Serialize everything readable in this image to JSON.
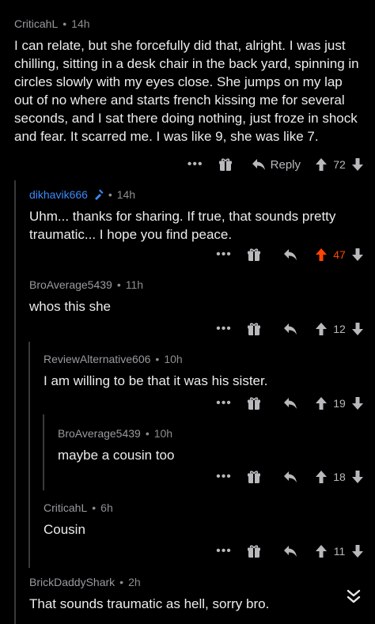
{
  "comments": [
    {
      "user": "CriticahL",
      "time": "14h",
      "mod": false,
      "text": "I can relate, but she forcefully did that, alright. I was just chilling, sitting in a desk chair in the back yard, spinning in circles slowly with my eyes close. She jumps on my lap out of no where and starts french kissing me for several seconds, and I sat there doing nothing, just froze in shock and fear. It scarred me. I was like 9, she was like 7.",
      "votes": "72",
      "upvoted": false,
      "reply_label": "Reply"
    },
    {
      "user": "dikhavik666",
      "time": "14h",
      "mod": true,
      "text": "Uhm... thanks for sharing. If true, that sounds pretty traumatic... I hope you find peace.",
      "votes": "47",
      "upvoted": true
    },
    {
      "user": "BroAverage5439",
      "time": "11h",
      "mod": false,
      "text": "whos this she",
      "votes": "12",
      "upvoted": false
    },
    {
      "user": "ReviewAlternative606",
      "time": "10h",
      "mod": false,
      "text": "I am willing to be that it was his sister.",
      "votes": "19",
      "upvoted": false
    },
    {
      "user": "BroAverage5439",
      "time": "10h",
      "mod": false,
      "text": "maybe a cousin too",
      "votes": "18",
      "upvoted": false
    },
    {
      "user": "CriticahL",
      "time": "6h",
      "mod": false,
      "text": "Cousin",
      "votes": "11",
      "upvoted": false
    },
    {
      "user": "BrickDaddyShark",
      "time": "2h",
      "mod": false,
      "text": "That sounds traumatic as hell, sorry bro."
    }
  ],
  "separator": "•",
  "more_label": "•••",
  "colors": {
    "accent_upvote": "#ff4500",
    "mod_username": "#3d8af7",
    "thread_line": "#3a3a3c"
  },
  "icons": [
    "more-icon",
    "gift-icon",
    "reply-icon",
    "upvote-icon",
    "downvote-icon",
    "scroll-down-chevron-icon",
    "shield-icon"
  ]
}
